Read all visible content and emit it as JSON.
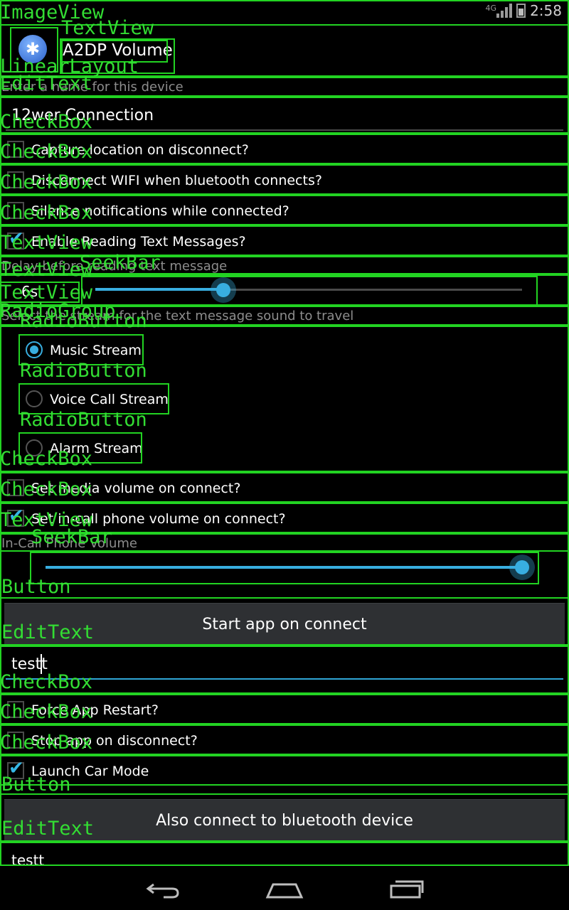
{
  "status": {
    "time": "2:58",
    "network": "4G"
  },
  "header": {
    "title": "A2DP Volume",
    "icon": "bluetooth-icon"
  },
  "name_field": {
    "hint": "Enter a name for this device",
    "value": "12wer Connection"
  },
  "checkboxes_top": [
    {
      "label": "Capture location on disconnect?",
      "checked": false
    },
    {
      "label": "Disconnect WIFI when bluetooth connects?",
      "checked": false
    },
    {
      "label": "Silence notifications while connected?",
      "checked": false
    },
    {
      "label": "Enable Reading Text Messages?",
      "checked": true
    }
  ],
  "delay": {
    "hint": "Delay before reading text message",
    "value": "6s",
    "slider_percent": 0.3
  },
  "stream": {
    "hint": "Select the stream for the text message sound to travel",
    "options": [
      {
        "label": "Music Stream",
        "selected": true
      },
      {
        "label": "Voice Call Stream",
        "selected": false
      },
      {
        "label": "Alarm Stream",
        "selected": false
      }
    ]
  },
  "volume_checks": [
    {
      "label": "Set media volume on connect?",
      "checked": false
    },
    {
      "label": "Set in-call phone volume on connect?",
      "checked": true
    }
  ],
  "incall": {
    "hint": "In-Call Phone Volume",
    "slider_percent": 1.0
  },
  "start_button": {
    "label": "Start app on connect"
  },
  "app_field": {
    "value": "testt"
  },
  "checkboxes_bottom": [
    {
      "label": "Force App Restart?",
      "checked": false
    },
    {
      "label": "Stop app on disconnect?",
      "checked": false
    },
    {
      "label": "Launch Car Mode",
      "checked": true
    }
  ],
  "connect_button": {
    "label": "Also connect to bluetooth device"
  },
  "bt_field": {
    "value": "testt"
  },
  "overlay_labels": [
    "ImageView",
    "TextView",
    "LinearLayout",
    "EditText",
    "CheckBox",
    "SeekBar",
    "RadioGroup",
    "RadioButton",
    "Button"
  ],
  "colors": {
    "accent": "#38aee0",
    "overlay": "#22d322",
    "background": "#000000"
  }
}
